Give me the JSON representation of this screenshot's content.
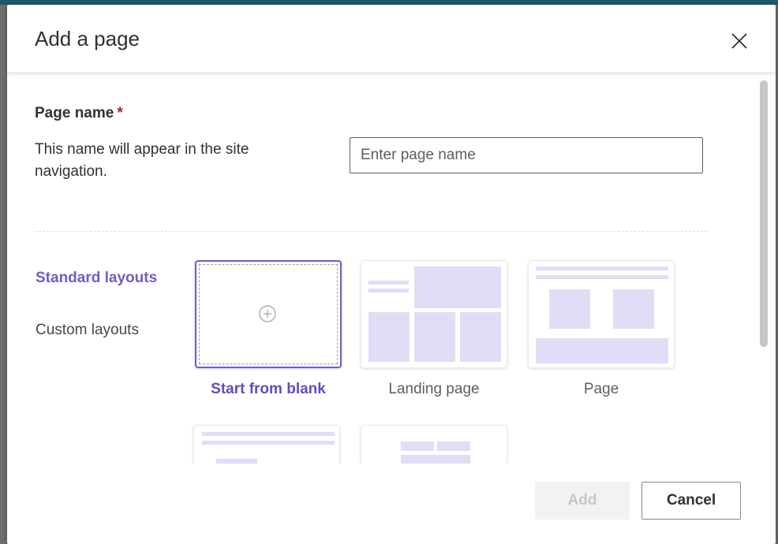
{
  "dialog": {
    "title": "Add a page",
    "close_icon": "close-icon"
  },
  "page_name": {
    "label": "Page name",
    "required_marker": "*",
    "helper": "This name will appear in the site navigation.",
    "input_value": "",
    "placeholder": "Enter page name"
  },
  "layout_categories": [
    {
      "label": "Standard layouts",
      "selected": true
    },
    {
      "label": "Custom layouts",
      "selected": false
    }
  ],
  "templates": [
    {
      "label": "Start from blank",
      "selected": true,
      "icon": "plus-circle-icon"
    },
    {
      "label": "Landing page",
      "selected": false
    },
    {
      "label": "Page",
      "selected": false
    }
  ],
  "buttons": {
    "add": "Add",
    "cancel": "Cancel",
    "add_enabled": false
  },
  "colors": {
    "accent": "#6b5fc7",
    "placeholder_block": "#e0ddf6",
    "required": "#a4262c"
  }
}
